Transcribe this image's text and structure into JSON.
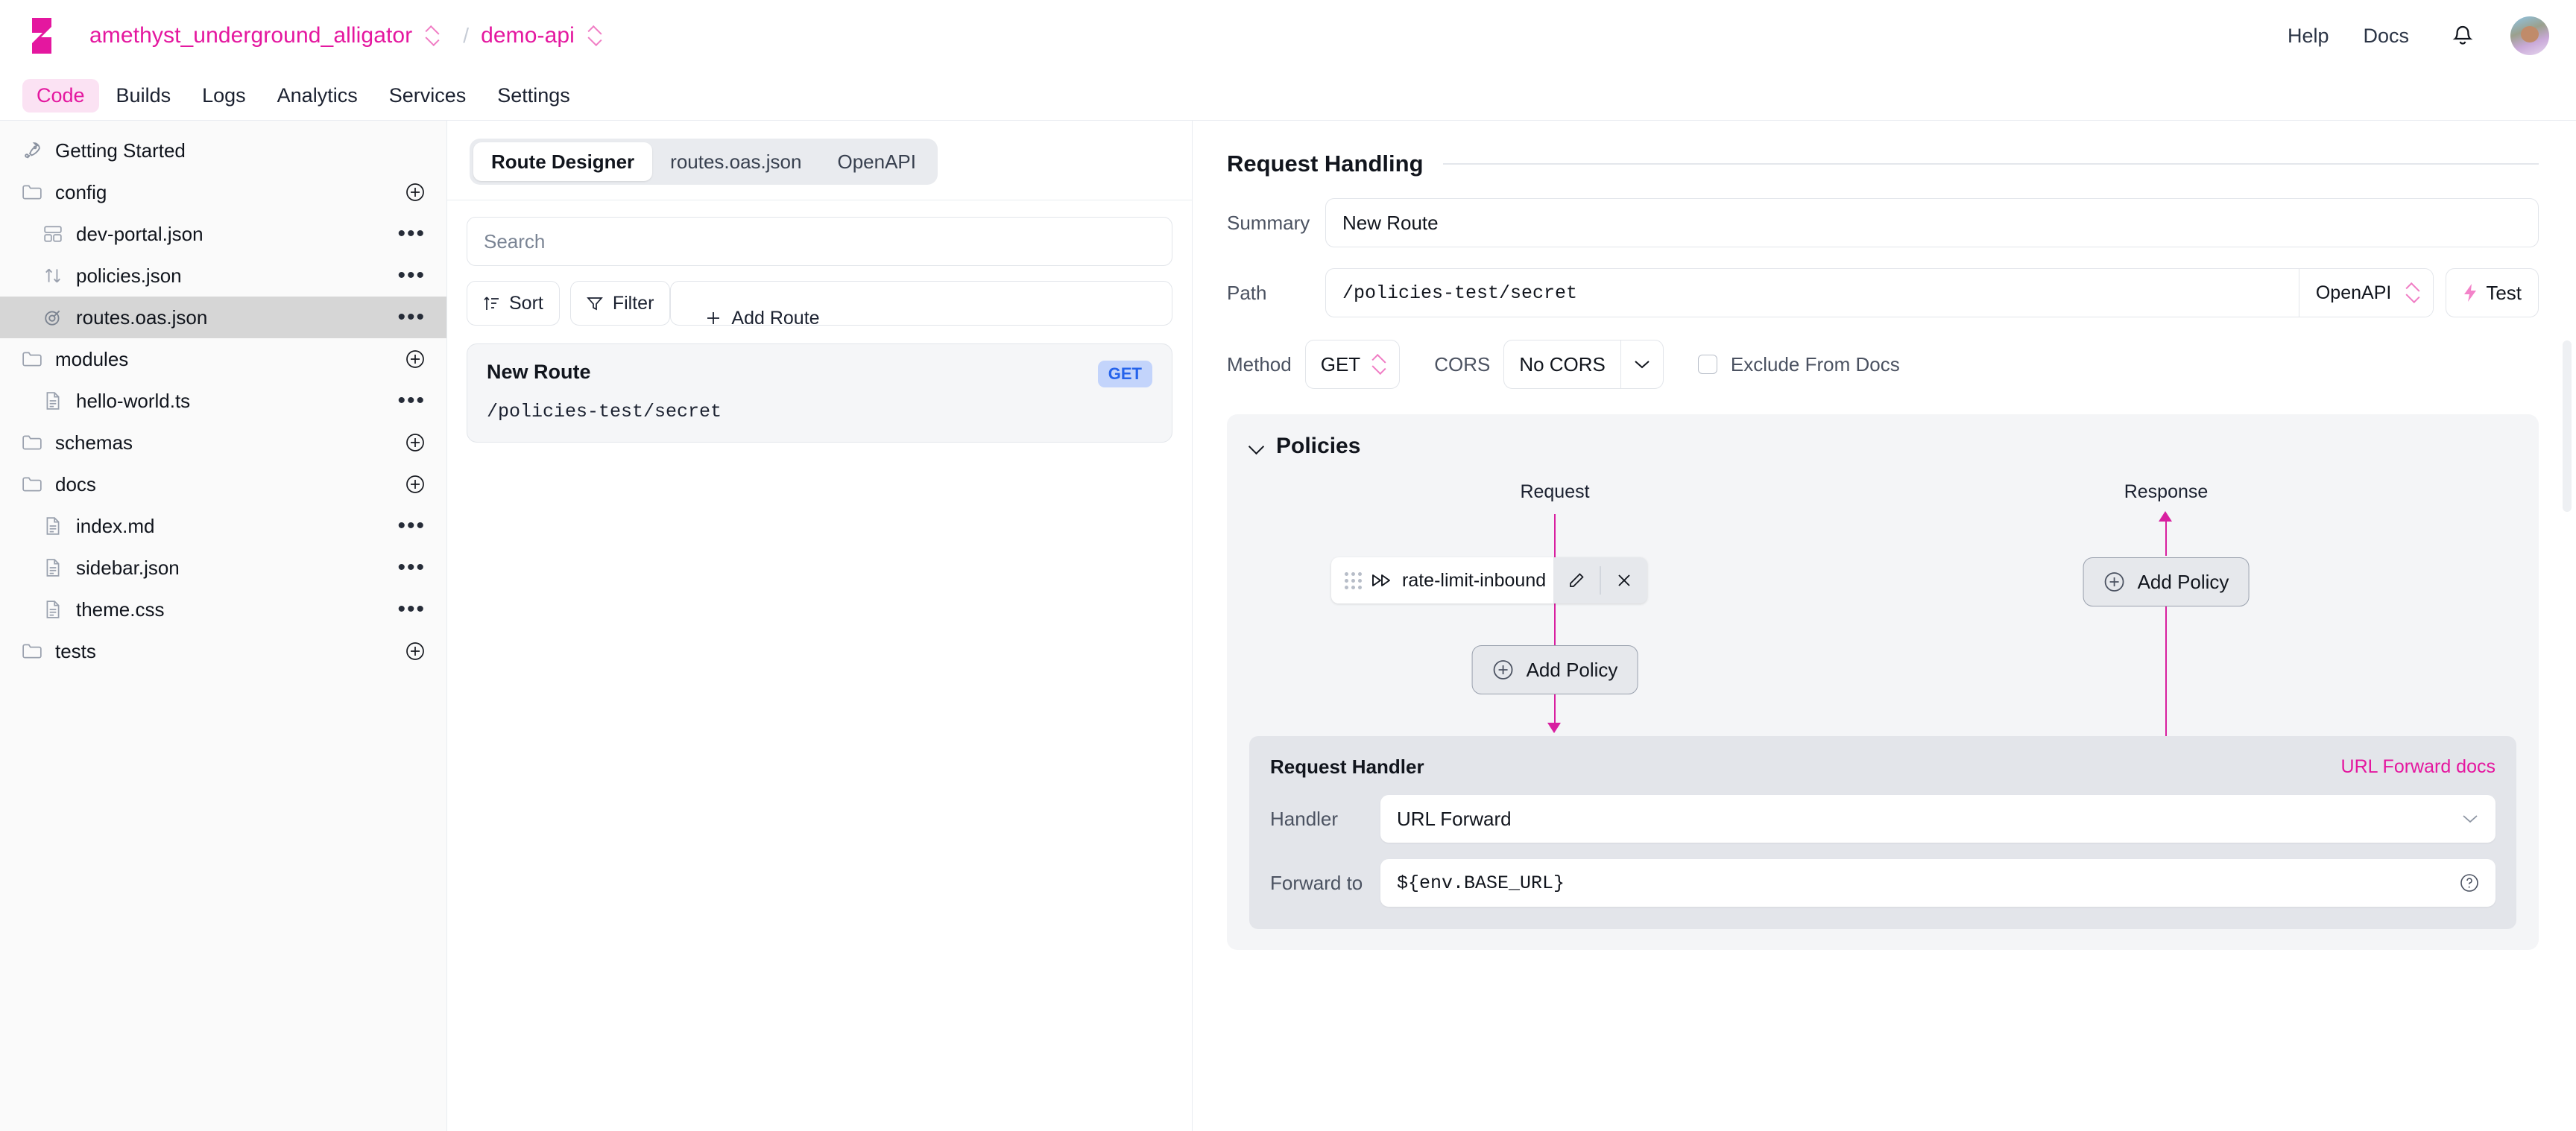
{
  "header": {
    "logo": "zuplo-logo",
    "org": "amethyst_underground_alligator",
    "separator": "/",
    "project": "demo-api",
    "help": "Help",
    "docs": "Docs",
    "bell_icon": "bell-icon",
    "avatar": "user-avatar"
  },
  "nav": {
    "tabs": [
      {
        "label": "Code",
        "active": true
      },
      {
        "label": "Builds",
        "active": false
      },
      {
        "label": "Logs",
        "active": false
      },
      {
        "label": "Analytics",
        "active": false
      },
      {
        "label": "Services",
        "active": false
      },
      {
        "label": "Settings",
        "active": false
      }
    ]
  },
  "sidebar": {
    "items": [
      {
        "label": "Getting Started",
        "icon": "rocket-icon",
        "kind": "link",
        "action": "none",
        "selected": false,
        "indent": false
      },
      {
        "label": "config",
        "icon": "folder-icon",
        "kind": "folder",
        "action": "plus",
        "selected": false,
        "indent": false
      },
      {
        "label": "dev-portal.json",
        "icon": "layout-icon",
        "kind": "file",
        "action": "dots",
        "selected": false,
        "indent": true
      },
      {
        "label": "policies.json",
        "icon": "arrows-updown-icon",
        "kind": "file",
        "action": "dots",
        "selected": false,
        "indent": true
      },
      {
        "label": "routes.oas.json",
        "icon": "target-icon",
        "kind": "file",
        "action": "dots",
        "selected": true,
        "indent": true
      },
      {
        "label": "modules",
        "icon": "folder-icon",
        "kind": "folder",
        "action": "plus",
        "selected": false,
        "indent": false
      },
      {
        "label": "hello-world.ts",
        "icon": "file-icon",
        "kind": "file",
        "action": "dots",
        "selected": false,
        "indent": true
      },
      {
        "label": "schemas",
        "icon": "folder-icon",
        "kind": "folder",
        "action": "plus",
        "selected": false,
        "indent": false
      },
      {
        "label": "docs",
        "icon": "folder-icon",
        "kind": "folder",
        "action": "plus",
        "selected": false,
        "indent": false
      },
      {
        "label": "index.md",
        "icon": "file-icon",
        "kind": "file",
        "action": "dots",
        "selected": false,
        "indent": true
      },
      {
        "label": "sidebar.json",
        "icon": "file-icon",
        "kind": "file",
        "action": "dots",
        "selected": false,
        "indent": true
      },
      {
        "label": "theme.css",
        "icon": "file-icon",
        "kind": "file",
        "action": "dots",
        "selected": false,
        "indent": true
      },
      {
        "label": "tests",
        "icon": "folder-icon",
        "kind": "folder",
        "action": "plus",
        "selected": false,
        "indent": false
      }
    ]
  },
  "middle": {
    "tabs": [
      {
        "label": "Route Designer",
        "active": true
      },
      {
        "label": "routes.oas.json",
        "active": false
      },
      {
        "label": "OpenAPI",
        "active": false
      }
    ],
    "search_placeholder": "Search",
    "search_value": "",
    "sort_label": "Sort",
    "filter_label": "Filter",
    "add_route_label": "Add Route",
    "routes": [
      {
        "title": "New Route",
        "method": "GET",
        "path": "/policies-test/secret"
      }
    ]
  },
  "request_handling": {
    "title": "Request Handling",
    "summary_label": "Summary",
    "summary_value": "New Route",
    "path_label": "Path",
    "path_value": "/policies-test/secret",
    "path_source": "OpenAPI",
    "test_label": "Test",
    "method_label": "Method",
    "method_value": "GET",
    "cors_label": "CORS",
    "cors_value": "No CORS",
    "exclude_label": "Exclude From Docs",
    "exclude_checked": false
  },
  "policies": {
    "title": "Policies",
    "request_label": "Request",
    "response_label": "Response",
    "request_policies": [
      {
        "name": "rate-limit-inbound",
        "edit_icon": "pencil-icon",
        "remove_icon": "close-icon",
        "drag_icon": "drag-handle-icon",
        "type_icon": "fast-forward-icon"
      }
    ],
    "request_add_label": "Add Policy",
    "response_add_label": "Add Policy",
    "handler": {
      "title": "Request Handler",
      "docs_link": "URL Forward docs",
      "handler_label": "Handler",
      "handler_value": "URL Forward",
      "forward_label": "Forward to",
      "forward_value": "${env.BASE_URL}"
    }
  },
  "colors": {
    "brand_pink": "#e4179f",
    "flow_pink": "#d81fa0",
    "tab_active_bg": "#fbe2f3",
    "get_badge_bg": "#c3d4fb",
    "get_badge_fg": "#2563eb",
    "panel_bg": "#f4f5f7",
    "handler_bg": "#e3e5ea",
    "selected_row": "#d6d6d6"
  }
}
